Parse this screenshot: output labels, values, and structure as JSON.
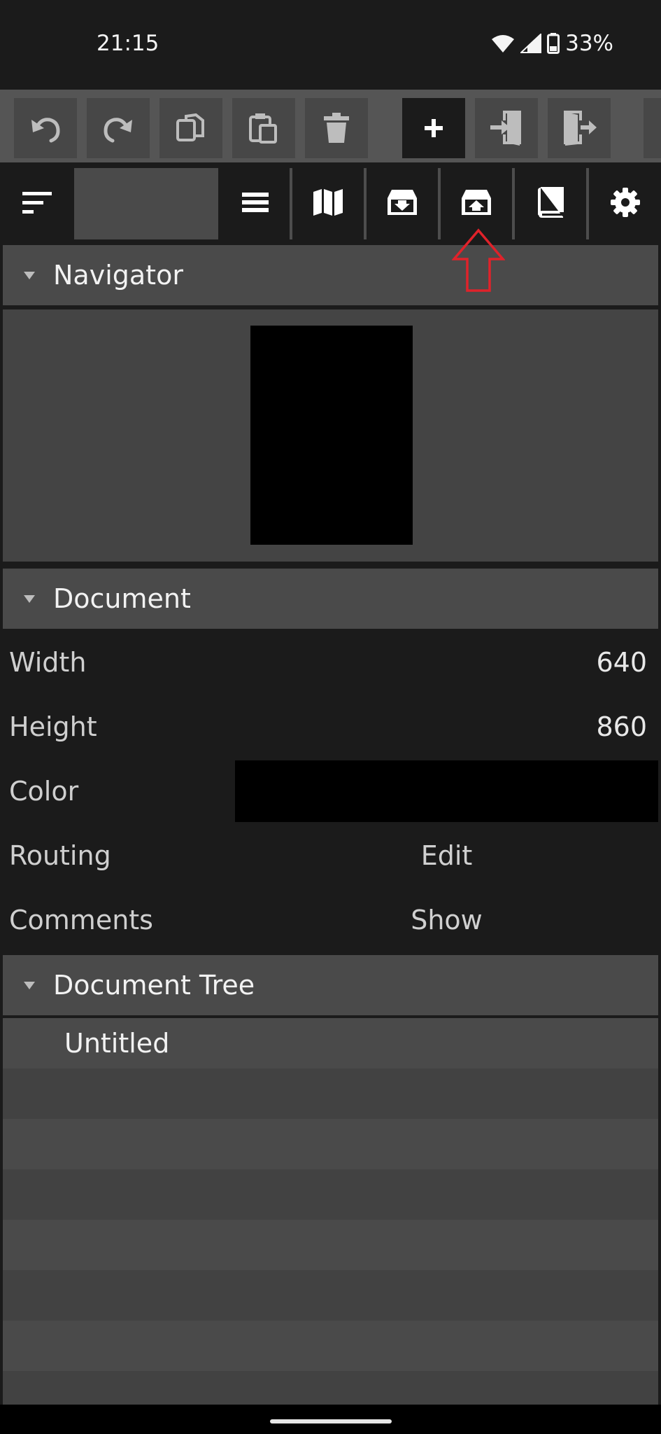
{
  "status_bar": {
    "time": "21:15",
    "battery_percent": "33%",
    "icons": [
      "wifi-icon",
      "cell-signal-icon",
      "battery-icon"
    ]
  },
  "toolbar": {
    "buttons": [
      {
        "name": "undo",
        "icon": "undo-icon"
      },
      {
        "name": "redo",
        "icon": "redo-icon"
      },
      {
        "name": "copy",
        "icon": "copy-icon"
      },
      {
        "name": "paste",
        "icon": "paste-icon"
      },
      {
        "name": "delete",
        "icon": "trash-icon"
      },
      {
        "name": "add",
        "icon": "plus-icon"
      },
      {
        "name": "import",
        "icon": "login-icon"
      },
      {
        "name": "export",
        "icon": "logout-icon"
      }
    ]
  },
  "tabs": [
    {
      "name": "sort",
      "icon": "sort-lines-icon"
    },
    {
      "name": "layers",
      "icon": "layers-icon"
    },
    {
      "name": "map",
      "icon": "map-icon"
    },
    {
      "name": "archive-in",
      "icon": "archive-download-icon"
    },
    {
      "name": "archive-out",
      "icon": "archive-upload-icon"
    },
    {
      "name": "book",
      "icon": "book-icon"
    },
    {
      "name": "settings",
      "icon": "gear-icon"
    }
  ],
  "navigator": {
    "title": "Navigator"
  },
  "document": {
    "title": "Document",
    "properties": [
      {
        "label": "Width",
        "value": "640"
      },
      {
        "label": "Height",
        "value": "860"
      },
      {
        "label": "Color",
        "value": ""
      },
      {
        "label": "Routing",
        "value": "Edit"
      },
      {
        "label": "Comments",
        "value": "Show"
      }
    ],
    "color_value": "#000000"
  },
  "document_tree": {
    "title": "Document Tree",
    "items": [
      "Untitled"
    ]
  },
  "colors": {
    "background": "#1b1b1b",
    "panel_header": "#4a4a4a",
    "toolbar": "#555555",
    "annotation_arrow": "#e0222a"
  }
}
